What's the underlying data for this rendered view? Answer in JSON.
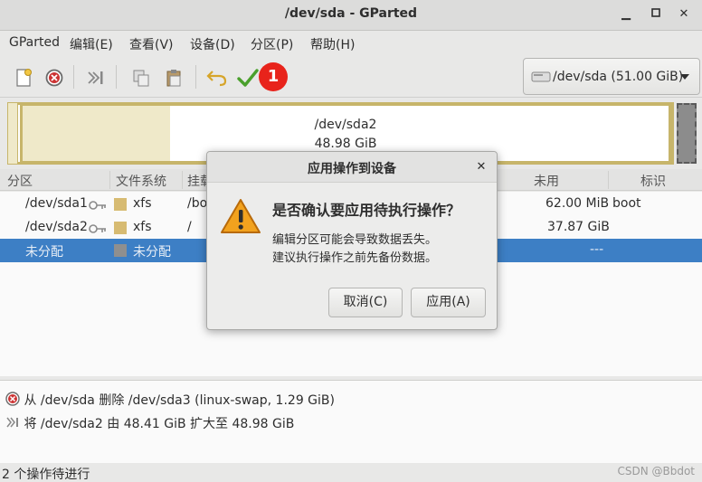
{
  "window": {
    "title": "/dev/sda - GParted"
  },
  "menu": [
    "GParted",
    "编辑(E)",
    "查看(V)",
    "设备(D)",
    "分区(P)",
    "帮助(H)"
  ],
  "toolbar": {
    "icons": [
      "new-partition-icon",
      "delete-icon",
      "resize-move-icon",
      "copy-icon",
      "paste-icon",
      "undo-icon",
      "apply-icon"
    ],
    "badge": "1"
  },
  "device_selector": {
    "label": "/dev/sda   (51.00 GiB)"
  },
  "partition_map": {
    "name": "/dev/sda2",
    "size": "48.98 GiB"
  },
  "table": {
    "headers": [
      "分区",
      "文件系统",
      "挂载",
      "未用",
      "标识"
    ],
    "rows": [
      {
        "partition": "/dev/sda1",
        "fs": "xfs",
        "mount": "/boot",
        "unused": "62.00 MiB",
        "flags": "boot",
        "color": "#d7bb72"
      },
      {
        "partition": "/dev/sda2",
        "fs": "xfs",
        "mount": "/",
        "unused": "37.87 GiB",
        "flags": "",
        "color": "#d7bb72"
      },
      {
        "partition": "未分配",
        "fs": "未分配",
        "mount": "",
        "unused": "---",
        "flags": "",
        "color": "#8f8f8f"
      }
    ]
  },
  "operations": [
    {
      "icon": "delete-icon",
      "text": "从 /dev/sda 删除 /dev/sda3 (linux-swap, 1.29 GiB)"
    },
    {
      "icon": "resize-move-icon",
      "text": "将 /dev/sda2 由 48.41 GiB 扩大至 48.98 GiB"
    }
  ],
  "status": "2 个操作待进行",
  "watermark": "CSDN @Bbdot",
  "dialog": {
    "title": "应用操作到设备",
    "heading": "是否确认要应用待执行操作？",
    "message_line1": "编辑分区可能会导致数据丢失。",
    "message_line2": "建议执行操作之前先备份数据。",
    "cancel_label": "取消(C)",
    "apply_label": "应用(A)"
  },
  "colors": {
    "selection": "#3d7fc5",
    "xfs": "#d7bb72",
    "badge": "#e8231b"
  }
}
